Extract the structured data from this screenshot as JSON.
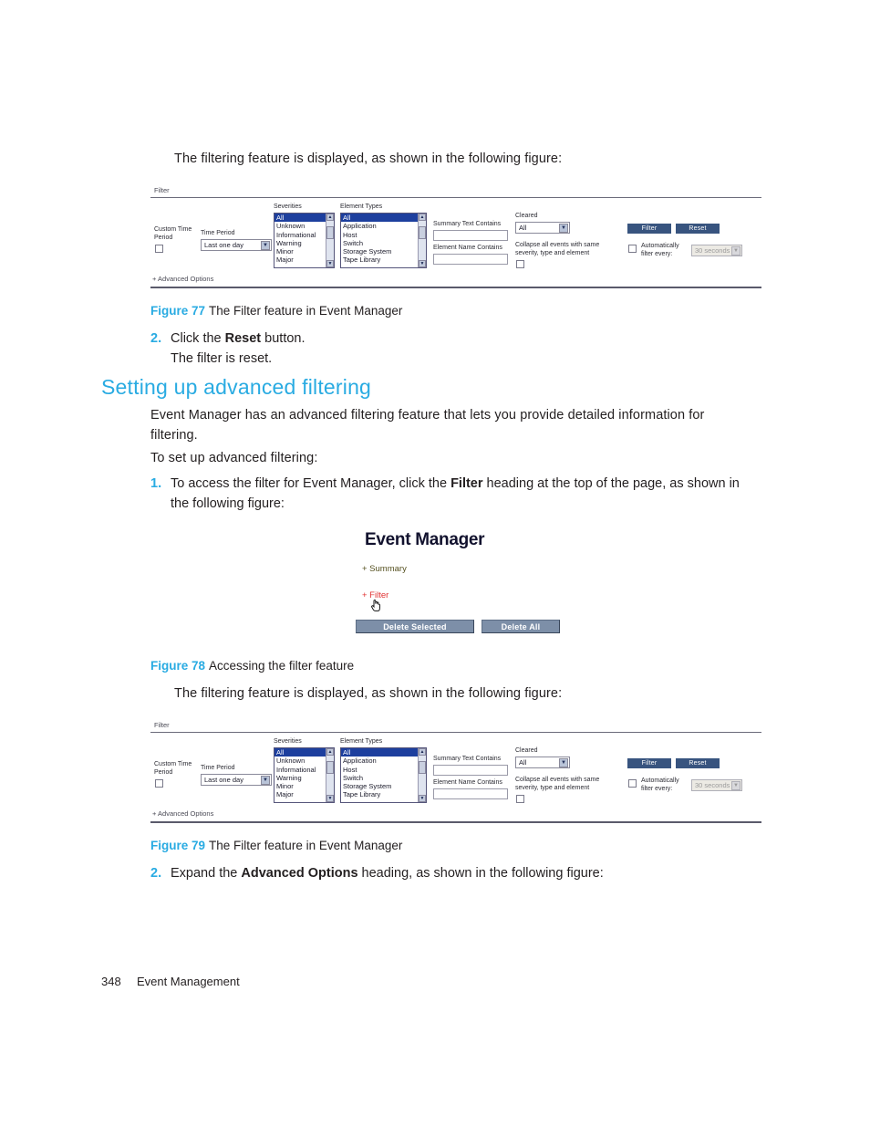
{
  "document": {
    "footer_page_number": "348",
    "footer_section": "Event Management",
    "intro_paragraph_1": "The filtering feature is displayed, as shown in the following figure:",
    "intro_paragraph_2": "The filtering feature is displayed, as shown in the following figure:",
    "section_heading": "Setting up advanced filtering",
    "paragraph_advanced_intro": "Event Manager has an advanced filtering feature that lets you provide detailed information for filtering.",
    "paragraph_to_setup": "To set up advanced filtering:"
  },
  "captions": {
    "figure_77_label": "Figure 77",
    "figure_77_text": "The Filter feature in Event Manager",
    "figure_78_label": "Figure 78",
    "figure_78_text": "Accessing the filter feature",
    "figure_79_label": "Figure 79",
    "figure_79_text": "The Filter feature in Event Manager"
  },
  "steps": {
    "step_2_reset_num": "2.",
    "step_2_reset_html": "Click the <b>Reset</b> button.",
    "step_2_reset_result": "The filter is reset.",
    "step_1_access_num": "1.",
    "step_1_access_html": "To access the filter for Event Manager, click the <b>Filter</b> heading at the top of the page, as shown in the following figure:",
    "step_2_expand_num": "2.",
    "step_2_expand_html": "Expand the <b>Advanced Options</b> heading, as shown in the following figure:"
  },
  "filter_panel": {
    "panel_title": "Filter",
    "advanced_options_link": "+ Advanced Options",
    "custom_time_period_label": "Custom Time Period",
    "time_period_label": "Time Period",
    "time_period_value": "Last one day",
    "severities_label": "Severities",
    "severities_options": [
      "All",
      "Unknown",
      "Informational",
      "Warning",
      "Minor",
      "Major"
    ],
    "severities_selected": "All",
    "element_types_label": "Element Types",
    "element_types_options": [
      "All",
      "Application",
      "Host",
      "Switch",
      "Storage System",
      "Tape Library"
    ],
    "element_types_selected": "All",
    "summary_text_contains_label": "Summary Text Contains",
    "summary_text_contains_value": "",
    "element_name_contains_label": "Element Name Contains",
    "element_name_contains_value": "",
    "cleared_label": "Cleared",
    "cleared_value": "All",
    "collapse_label": "Collapse all events with same severity, type and element",
    "filter_button": "Filter",
    "reset_button": "Reset",
    "auto_filter_label": "Automatically filter every:",
    "auto_filter_interval": "30 seconds"
  },
  "event_manager": {
    "title": "Event Manager",
    "summary_link": "+ Summary",
    "filter_link": "+ Filter",
    "delete_selected_button": "Delete Selected",
    "delete_all_button": "Delete All"
  },
  "colors": {
    "accent_cyan": "#29ABE2",
    "body_text": "#231f20",
    "filter_button_blue": "#38547f",
    "em_button_gray": "#7d8fa8",
    "list_selected_blue": "#1d3f9e",
    "filter_link_red": "#e03030"
  }
}
